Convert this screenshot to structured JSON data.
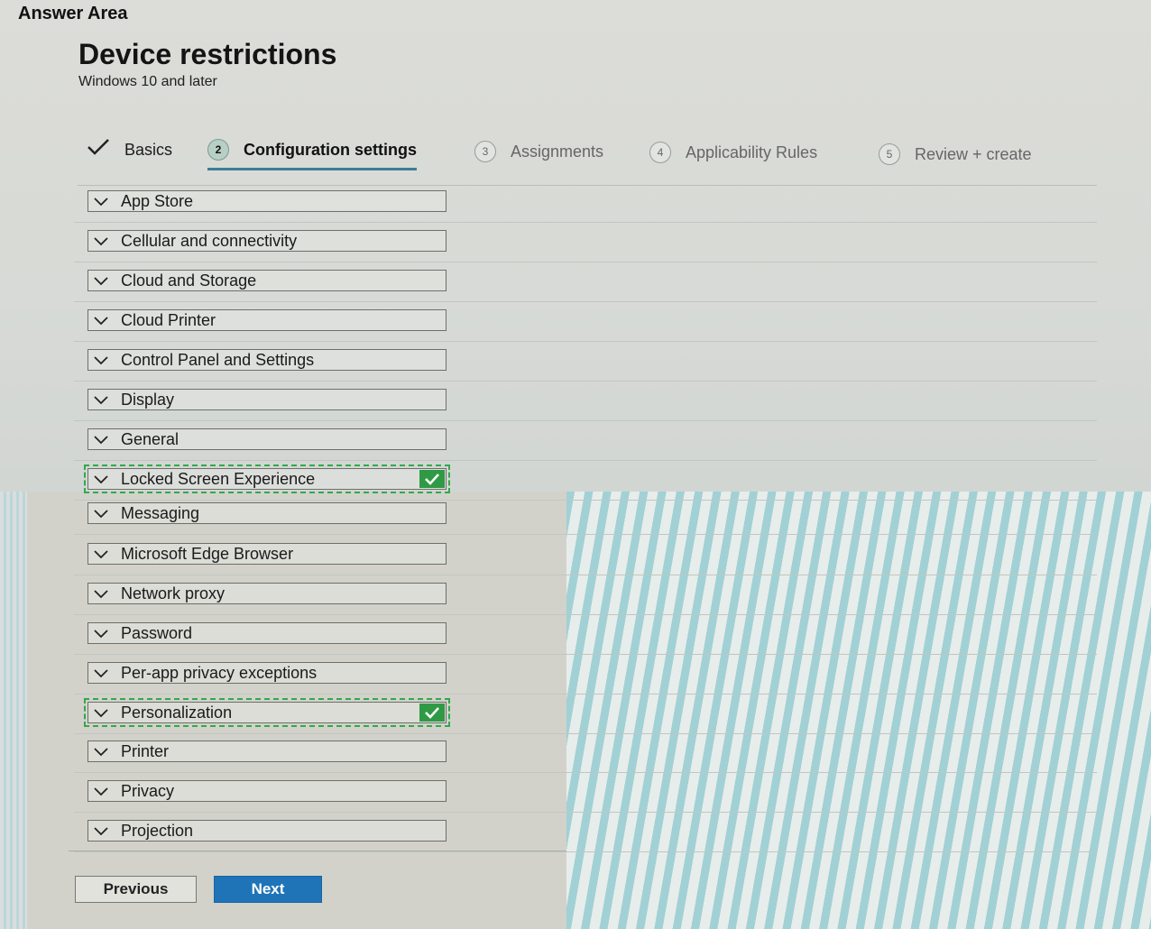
{
  "answer_area": "Answer Area",
  "header": {
    "title": "Device restrictions",
    "subtitle": "Windows 10 and later"
  },
  "tabs": [
    {
      "label": "Basics",
      "state": "completed"
    },
    {
      "label": "Configuration settings",
      "step": "2",
      "state": "active"
    },
    {
      "label": "Assignments",
      "step": "3",
      "state": "inactive"
    },
    {
      "label": "Applicability Rules",
      "step": "4",
      "state": "inactive"
    },
    {
      "label": "Review + create",
      "step": "5",
      "state": "inactive"
    }
  ],
  "settings": [
    {
      "label": "App Store",
      "selected": false
    },
    {
      "label": "Cellular and connectivity",
      "selected": false
    },
    {
      "label": "Cloud and Storage",
      "selected": false
    },
    {
      "label": "Cloud Printer",
      "selected": false
    },
    {
      "label": "Control Panel and Settings",
      "selected": false
    },
    {
      "label": "Display",
      "selected": false
    },
    {
      "label": "General",
      "selected": false
    },
    {
      "label": "Locked Screen Experience",
      "selected": true
    },
    {
      "label": "Messaging",
      "selected": false
    },
    {
      "label": "Microsoft Edge Browser",
      "selected": false
    },
    {
      "label": "Network proxy",
      "selected": false
    },
    {
      "label": "Password",
      "selected": false
    },
    {
      "label": "Per-app privacy exceptions",
      "selected": false
    },
    {
      "label": "Personalization",
      "selected": true
    },
    {
      "label": "Printer",
      "selected": false
    },
    {
      "label": "Privacy",
      "selected": false
    },
    {
      "label": "Projection",
      "selected": false
    }
  ],
  "footer": {
    "previous_label": "Previous",
    "next_label": "Next"
  },
  "colors": {
    "primary_button": "#1f74b8",
    "selection_green": "#2f9a45",
    "active_tab_underline": "#3a7f95"
  }
}
